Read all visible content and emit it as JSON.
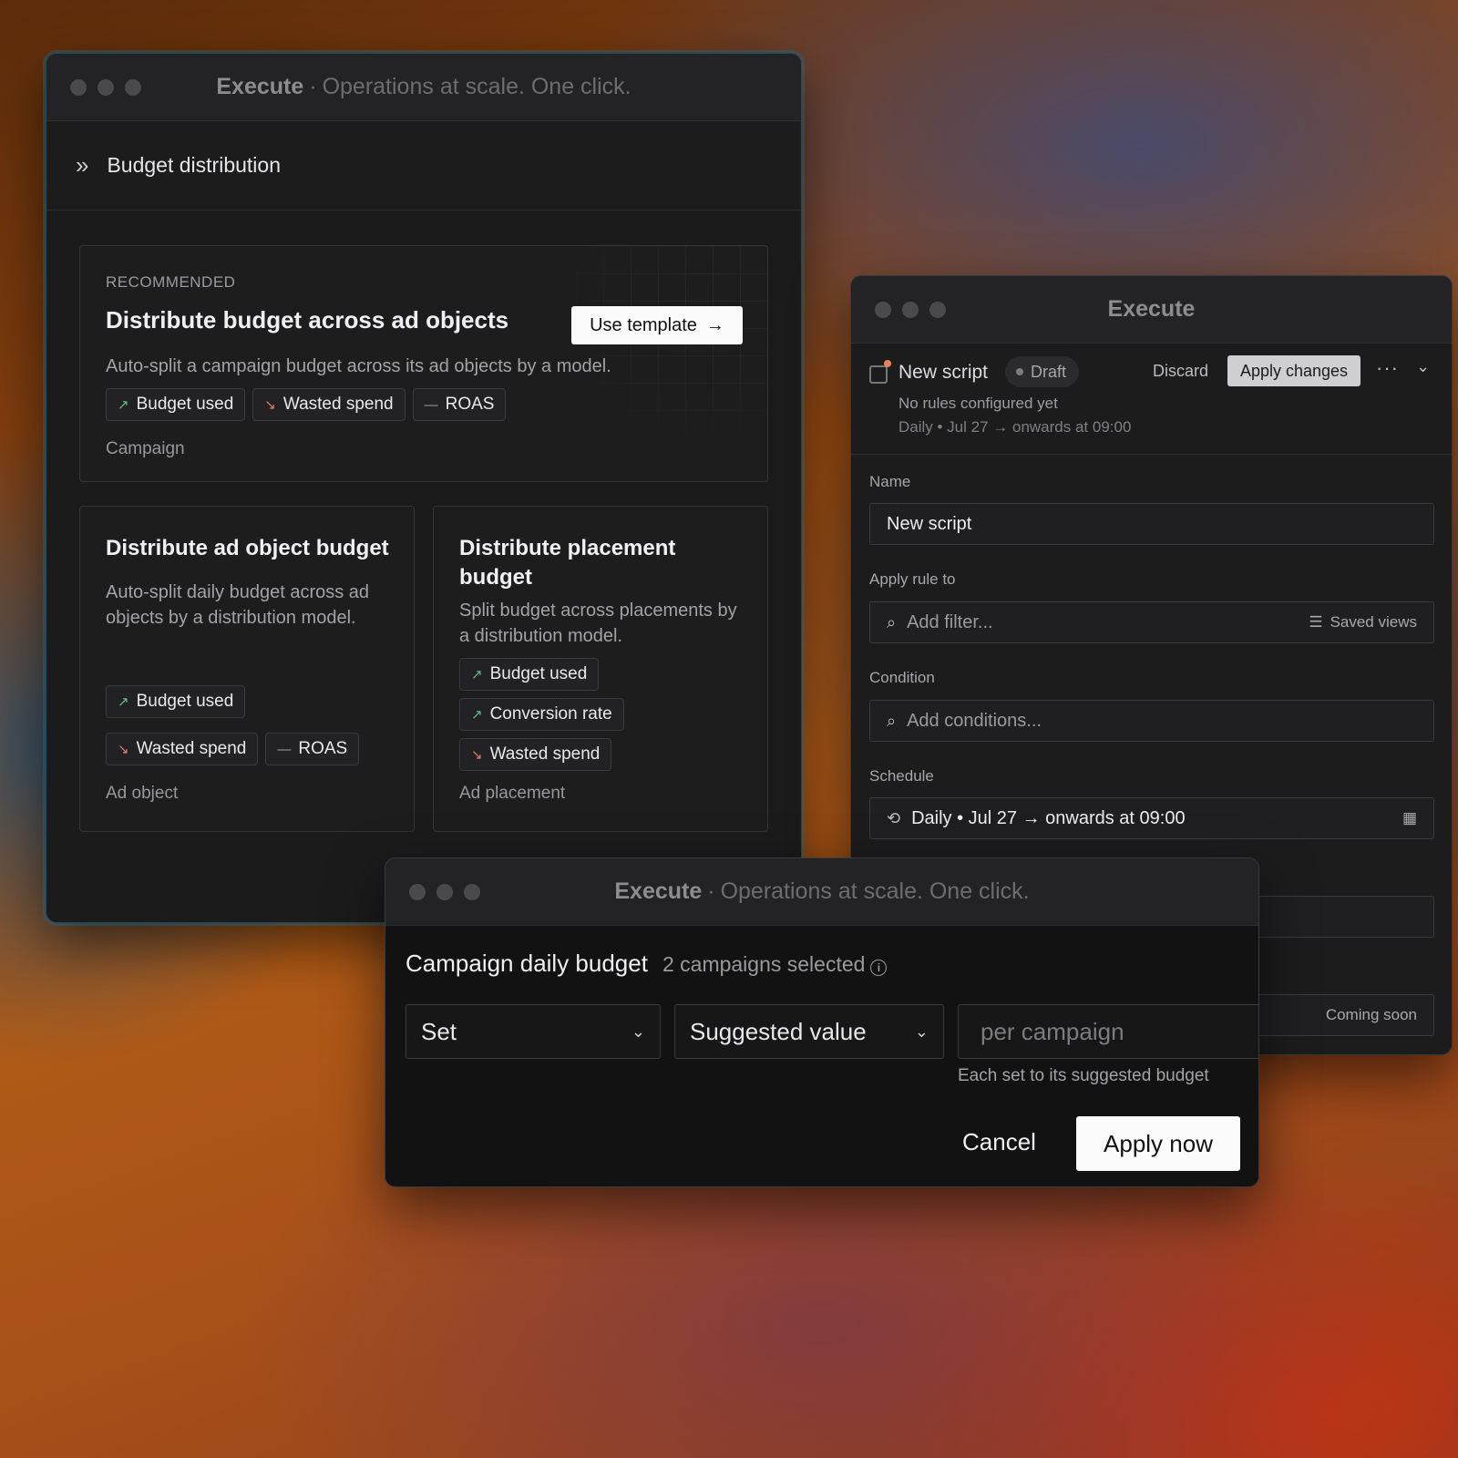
{
  "window_budget": {
    "title_main": "Execute",
    "title_sep": "·",
    "title_sub": "Operations at scale. One click.",
    "header_title": "Budget distribution",
    "recommended": {
      "eyebrow": "RECOMMENDED",
      "title": "Distribute budget across ad objects",
      "button": "Use template",
      "description": "Auto-split a campaign budget across its ad objects by a model.",
      "chips": [
        "Budget used",
        "Wasted spend",
        "ROAS"
      ],
      "footer": "Campaign"
    },
    "card_ad_object": {
      "title": "Distribute ad object budget",
      "description": "Auto-split daily budget across ad objects by a distribution model.",
      "chips": [
        "Budget used",
        "Wasted spend",
        "ROAS"
      ],
      "footer": "Ad object"
    },
    "card_placement": {
      "title": "Distribute placement budget",
      "description": "Split budget across placements by a distribution model.",
      "chips": [
        "Budget used",
        "Conversion rate",
        "Wasted spend"
      ],
      "footer": "Ad placement"
    }
  },
  "window_script": {
    "title": "Execute",
    "script_name": "New script",
    "status": "Draft",
    "discard": "Discard",
    "apply_changes": "Apply changes",
    "no_rules": "No rules configured yet",
    "schedule_summary": "Daily • Jul 27 → onwards at 09:00",
    "name_label": "Name",
    "name_value": "New script",
    "apply_rule_label": "Apply rule to",
    "filter_placeholder": "Add filter...",
    "saved_views": "Saved views",
    "condition_label": "Condition",
    "condition_placeholder": "Add conditions...",
    "schedule_label": "Schedule",
    "schedule_value": "Daily • Jul 27 → onwards at 09:00",
    "coming_soon": "Coming soon"
  },
  "window_apply": {
    "title_main": "Execute",
    "title_sep": "·",
    "title_sub": "Operations at scale. One click.",
    "heading": "Campaign daily budget",
    "selection_count": "2 campaigns selected",
    "action_select": "Set",
    "value_select": "Suggested value",
    "amount_placeholder": "per campaign",
    "helper": "Each set to its suggested budget",
    "cancel": "Cancel",
    "apply_now": "Apply now"
  }
}
